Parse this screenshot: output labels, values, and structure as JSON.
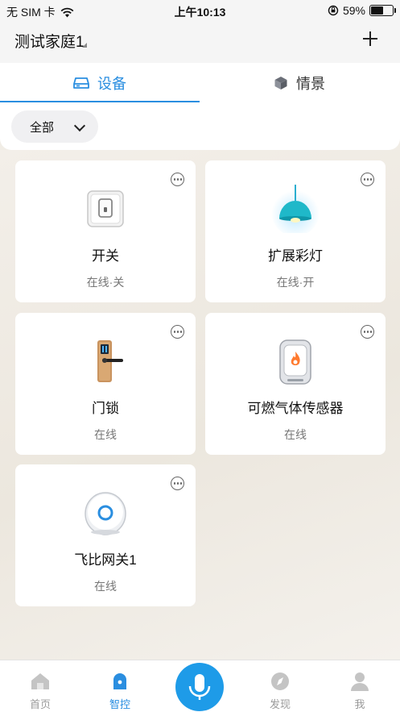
{
  "status_bar": {
    "carrier": "无 SIM 卡",
    "time": "上午10:13",
    "battery_percent": "59%",
    "battery_level": 0.59
  },
  "header": {
    "home_name": "测试家庭1",
    "add_icon": "plus-icon"
  },
  "tabs": [
    {
      "label": "设备",
      "icon": "device-icon",
      "active": true
    },
    {
      "label": "情景",
      "icon": "cube-icon",
      "active": false
    }
  ],
  "filter": {
    "selected": "全部",
    "icon": "chevron-down-icon"
  },
  "devices": [
    {
      "name": "开关",
      "status": "在线·关",
      "icon": "switch-icon"
    },
    {
      "name": "扩展彩灯",
      "status": "在线·开",
      "icon": "lamp-icon"
    },
    {
      "name": "门锁",
      "status": "在线",
      "icon": "door-lock-icon"
    },
    {
      "name": "可燃气体传感器",
      "status": "在线",
      "icon": "gas-sensor-icon"
    },
    {
      "name": "飞比网关1",
      "status": "在线",
      "icon": "gateway-icon"
    }
  ],
  "bottom_nav": [
    {
      "label": "首页",
      "icon": "home-icon",
      "active": false
    },
    {
      "label": "智控",
      "icon": "smart-control-icon",
      "active": true
    },
    {
      "label": "",
      "icon": "microphone-icon",
      "active": false
    },
    {
      "label": "发现",
      "icon": "compass-icon",
      "active": false
    },
    {
      "label": "我",
      "icon": "user-icon",
      "active": false
    }
  ],
  "colors": {
    "accent": "#2a8ee0",
    "mic_button": "#1e9be8",
    "inactive": "#9a9a9a"
  }
}
